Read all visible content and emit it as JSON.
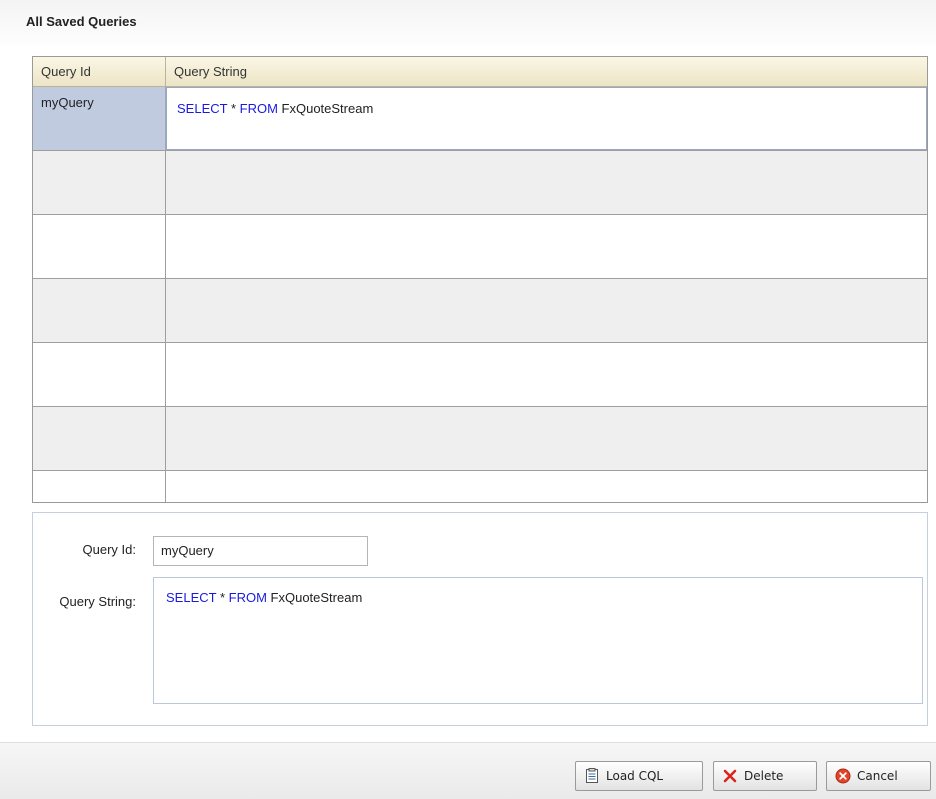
{
  "panel": {
    "title": "All Saved Queries"
  },
  "table": {
    "headers": [
      "Query Id",
      "Query String"
    ],
    "rows": [
      {
        "id": "myQuery",
        "query": {
          "kw1": "SELECT",
          "sym": " * ",
          "kw2": "FROM",
          "rest": " FxQuoteStream"
        }
      }
    ]
  },
  "form": {
    "id_label": "Query Id:",
    "id_value": "myQuery",
    "string_label": "Query String:",
    "string_value": {
      "kw1": "SELECT",
      "sym": " * ",
      "kw2": "FROM",
      "rest": " FxQuoteStream"
    }
  },
  "buttons": {
    "load_cql": "Load CQL",
    "delete": "Delete",
    "cancel": "Cancel"
  },
  "colors": {
    "keyword": "#1a1adf",
    "selected_cell": "#c1cbe0",
    "header_bg": "#ece4c6"
  },
  "icons": {
    "load": "document-list-icon",
    "delete": "red-x-icon",
    "cancel": "cancel-circle-icon"
  }
}
